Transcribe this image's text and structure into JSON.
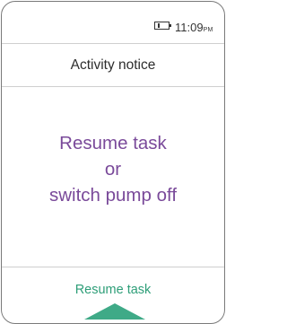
{
  "status_bar": {
    "battery_icon": "battery-low-icon",
    "time": "11:09",
    "ampm": "PM"
  },
  "header": {
    "title": "Activity notice"
  },
  "message": {
    "line1": "Resume task",
    "line2": "or",
    "line3": "switch pump off"
  },
  "action": {
    "label": "Resume task",
    "arrow_icon": "up-arrow-icon"
  },
  "colors": {
    "message_purple": "#7a4a9a",
    "action_green": "#2e9e78",
    "arrow_green": "#3faa87"
  }
}
